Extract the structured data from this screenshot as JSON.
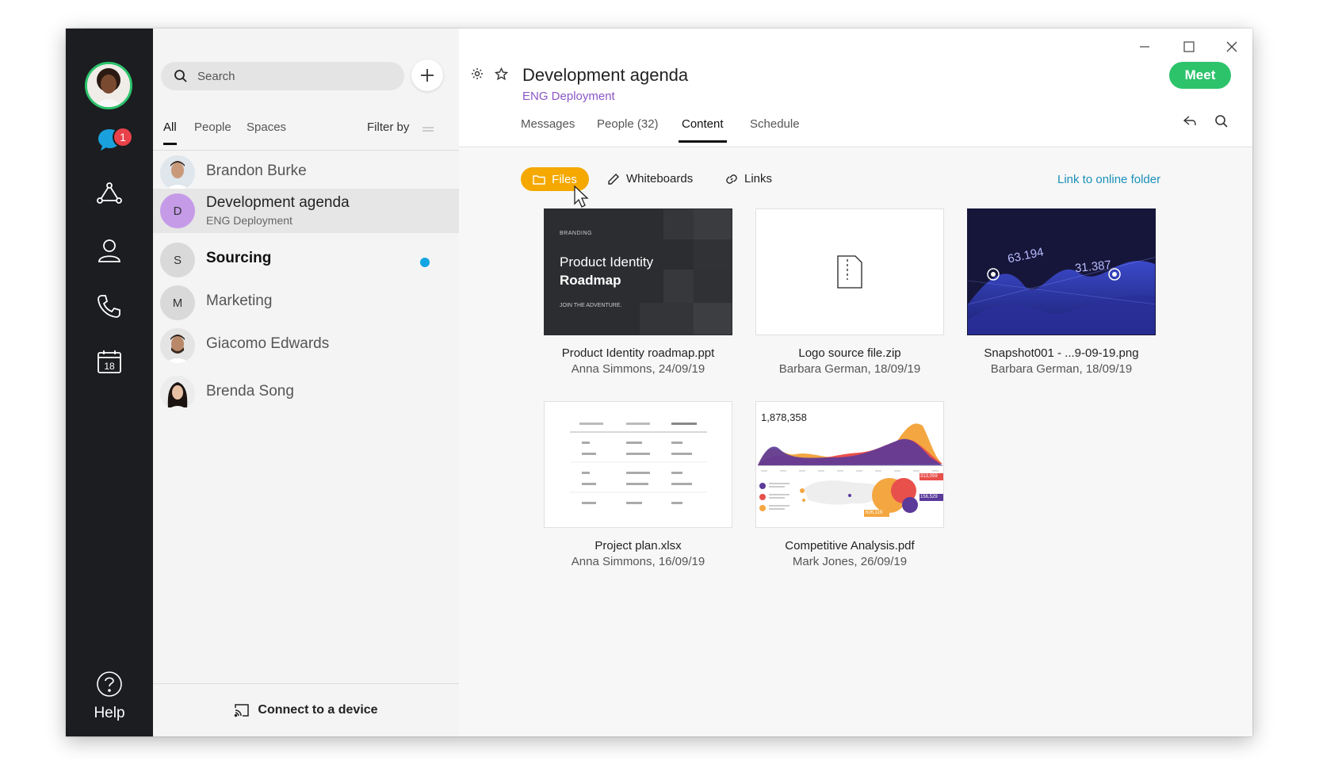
{
  "rail": {
    "messages_badge": "1",
    "help_label": "Help",
    "calendar_day": "18"
  },
  "list": {
    "search_placeholder": "Search",
    "tabs": [
      "All",
      "People",
      "Spaces"
    ],
    "filter_label": "Filter by",
    "items": [
      {
        "name": "Brandon Burke",
        "sub": "",
        "initial": ""
      },
      {
        "name": "Development agenda",
        "sub": "ENG Deployment",
        "initial": "D"
      },
      {
        "name": "Sourcing",
        "sub": "",
        "initial": "S"
      },
      {
        "name": "Marketing",
        "sub": "",
        "initial": "M"
      },
      {
        "name": "Giacomo Edwards",
        "sub": "",
        "initial": ""
      },
      {
        "name": "Brenda Song",
        "sub": "",
        "initial": ""
      }
    ],
    "footer_label": "Connect to a device"
  },
  "main": {
    "title": "Development agenda",
    "subtitle": "ENG Deployment",
    "meet_label": "Meet",
    "tabs": [
      "Messages",
      "People (32)",
      "Content",
      "Schedule"
    ],
    "active_tab": "Content",
    "filters": {
      "files": "Files",
      "whiteboards": "Whiteboards",
      "links": "Links"
    },
    "online_folder": "Link to online folder",
    "files": [
      {
        "name": "Product Identity roadmap.ppt",
        "meta": "Anna Simmons, 24/09/19"
      },
      {
        "name": "Logo source file.zip",
        "meta": "Barbara German, 18/09/19"
      },
      {
        "name": "Snapshot001 - ...9-09-19.png",
        "meta": "Barbara German, 18/09/19"
      },
      {
        "name": "Project plan.xlsx",
        "meta": "Anna Simmons, 16/09/19"
      },
      {
        "name": "Competitive Analysis.pdf",
        "meta": "Mark Jones, 26/09/19"
      }
    ],
    "thumb_ppt": {
      "kicker": "BRANDING",
      "line1": "Product Identity",
      "line2": "Roadmap",
      "tagline": "JOIN THE ADVENTURE."
    },
    "thumb_png": {
      "label1": "63.194",
      "label2": "31.387"
    },
    "thumb_pdf": {
      "figure": "1,878,358",
      "tag1": "313,059",
      "tag2": "156,529",
      "tag3": "626,119"
    }
  },
  "colors": {
    "rail_bg": "#1b1d20",
    "accent_green": "#2cc36b",
    "files_yellow": "#f4a800",
    "badge_red": "#e8414a",
    "link_blue": "#1a8fb8",
    "space_purple": "#8b57c4"
  }
}
